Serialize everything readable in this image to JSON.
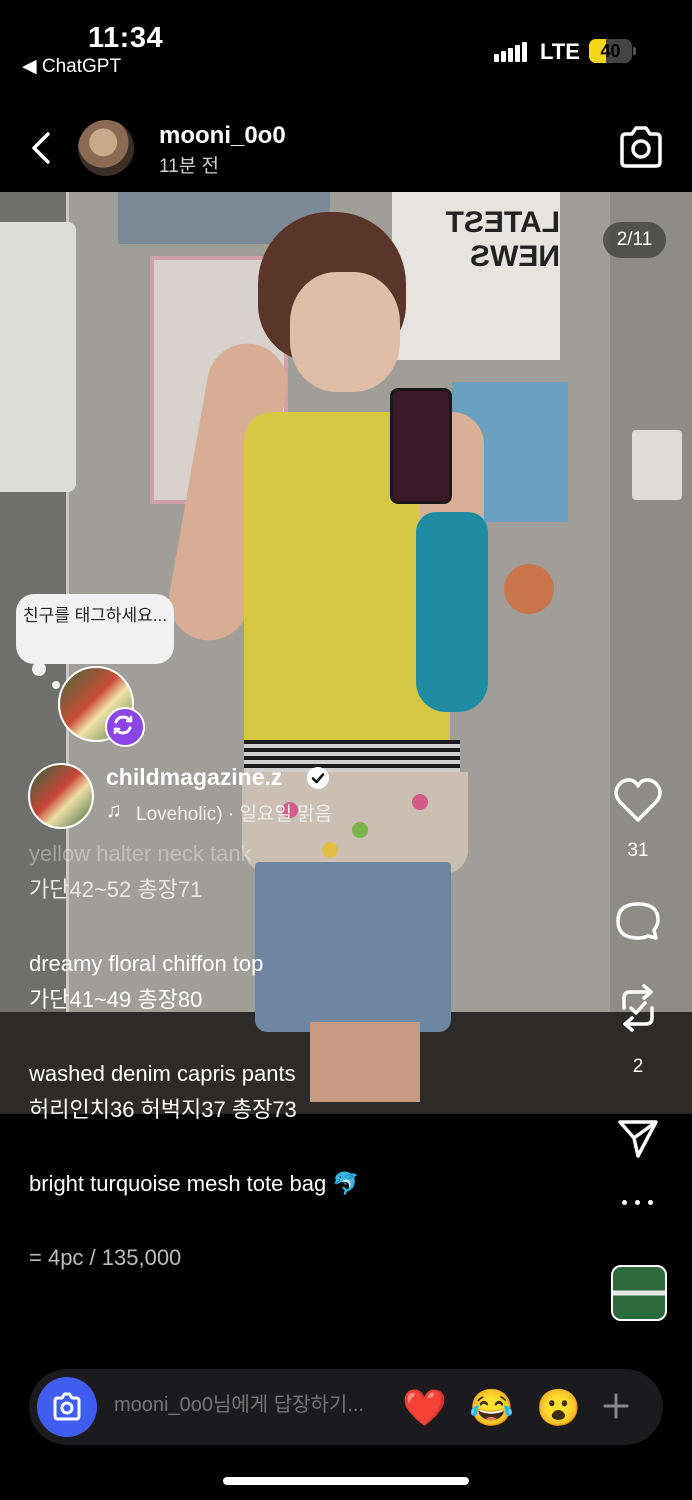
{
  "status_bar": {
    "time": "11:34",
    "back_app": "◀ ChatGPT",
    "carrier": "LTE",
    "battery": "40",
    "battery_level": 0.4
  },
  "header": {
    "username": "mooni_0o0",
    "time_ago": "11분 전"
  },
  "story": {
    "page_counter": "2/11",
    "tag_prompt": "친구를 태그하세요..."
  },
  "music": {
    "account": "childmagazine.z",
    "track": "Loveholic) · 일요일 맑음"
  },
  "caption": {
    "lines": [
      "yellow halter neck tank",
      "가단42~52 총장71",
      "dreamy floral chiffon top",
      "가단41~49 총장80",
      "washed denim capris pants",
      "허리인치36 허벅지37 총장73",
      "bright turquoise mesh tote bag 🐬",
      "= 4pc / 135,000"
    ]
  },
  "actions": {
    "like_count": "31",
    "repost_count": "2"
  },
  "reply": {
    "placeholder": "mooni_0o0님에게 답장하기...",
    "emojis": [
      "❤️",
      "😂",
      "😮"
    ]
  },
  "colors": {
    "accent_blue": "#3f5ef0",
    "repost_purple": "#8a44e8",
    "battery_yellow": "#f5d518"
  }
}
